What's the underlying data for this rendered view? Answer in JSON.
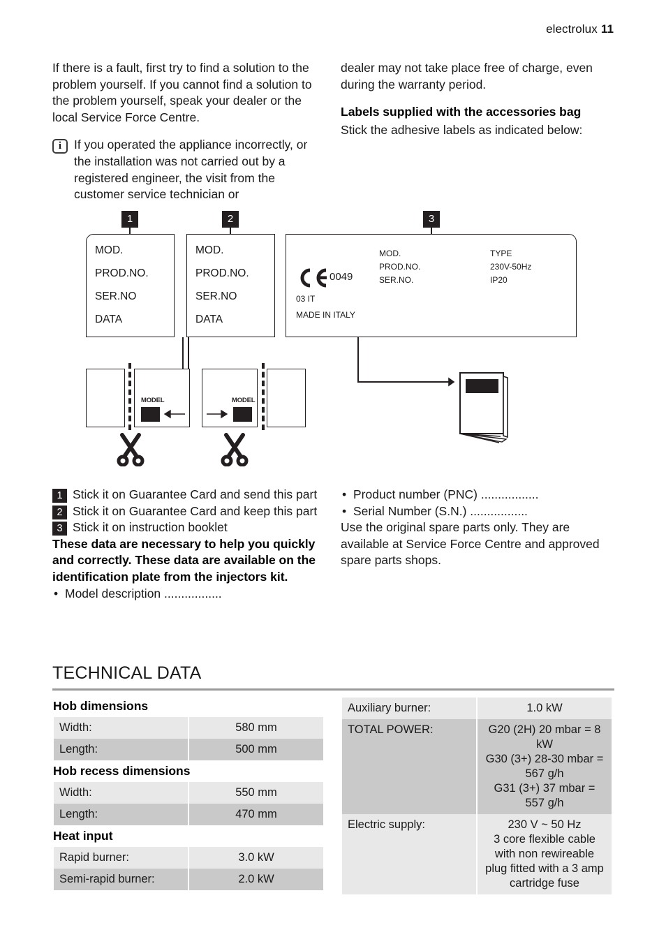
{
  "header": {
    "brand": "electrolux",
    "page_number": "11"
  },
  "left_column": {
    "intro_paragraph": "If there is a fault, first try to find a solution to the problem yourself. If you cannot find a solution to the problem yourself, speak your dealer or the local Service Force Centre.",
    "note_icon": "info-icon",
    "note_text": "If you operated the appliance incorrectly, or the installation was not carried out by a registered engineer, the visit from the customer service technician or"
  },
  "right_column": {
    "continuation_paragraph": "dealer may not take place free of charge, even during the warranty period.",
    "subheading": "Labels supplied with the accessories bag",
    "instruction": "Stick the adhesive labels as indicated below:"
  },
  "diagram": {
    "badges": [
      "1",
      "2",
      "3"
    ],
    "plate1_lines": [
      "MOD.",
      "PROD.NO.",
      "SER.NO",
      "DATA"
    ],
    "plate2_lines": [
      "MOD.",
      "PROD.NO.",
      "SER.NO",
      "DATA"
    ],
    "plate3": {
      "ce_mark": "CE",
      "ce_number": "0049",
      "code_line": "03   IT",
      "origin": "MADE IN ITALY",
      "col1": [
        "MOD.",
        "PROD.NO.",
        "SER.NO."
      ],
      "col2": [
        "TYPE",
        "230V-50Hz",
        "IP20"
      ]
    },
    "model_tag": "MODEL",
    "scissors_icon": "scissors-icon",
    "booklet_icon": "booklet-icon"
  },
  "steps": [
    {
      "num": "1",
      "text": "Stick it on Guarantee Card and send this part"
    },
    {
      "num": "2",
      "text": "Stick it on Guarantee Card and keep this part"
    },
    {
      "num": "3",
      "text": "Stick it on instruction booklet"
    }
  ],
  "steps_note": "These data are necessary to help you quickly and correctly. These data are available on the identification plate from the injectors kit.",
  "left_bullets": [
    "Model description ................."
  ],
  "right_bullets": [
    "Product number (PNC) .................",
    "Serial Number (S.N.) ................."
  ],
  "spare_parts_note": "Use the original spare parts only. They are available at Service Force Centre and approved spare parts shops.",
  "technical_data": {
    "title": "TECHNICAL DATA",
    "left_sections": [
      {
        "heading": "Hob dimensions",
        "rows": [
          {
            "key": "Width:",
            "value": "580 mm"
          },
          {
            "key": "Length:",
            "value": "500 mm"
          }
        ]
      },
      {
        "heading": "Hob recess dimensions",
        "rows": [
          {
            "key": "Width:",
            "value": "550 mm"
          },
          {
            "key": "Length:",
            "value": "470 mm"
          }
        ]
      },
      {
        "heading": "Heat input",
        "rows": [
          {
            "key": "Rapid burner:",
            "value": "3.0 kW"
          },
          {
            "key": "Semi-rapid burner:",
            "value": "2.0 kW"
          }
        ]
      }
    ],
    "right_rows": [
      {
        "key": "Auxiliary burner:",
        "value": "1.0 kW"
      },
      {
        "key": "TOTAL POWER:",
        "value": "G20 (2H) 20 mbar = 8 kW\nG30 (3+) 28-30 mbar = 567 g/h\nG31 (3+) 37 mbar = 557 g/h"
      },
      {
        "key": "Electric supply:",
        "value": "230 V ~ 50 Hz\n3 core flexible cable with non rewireable plug fitted with a 3 amp cartridge fuse"
      }
    ]
  },
  "colors": {
    "badge": "#231f20",
    "rule": "#9a9a9a",
    "row_odd": "#e8e8e8",
    "row_even": "#c9c9c9"
  }
}
